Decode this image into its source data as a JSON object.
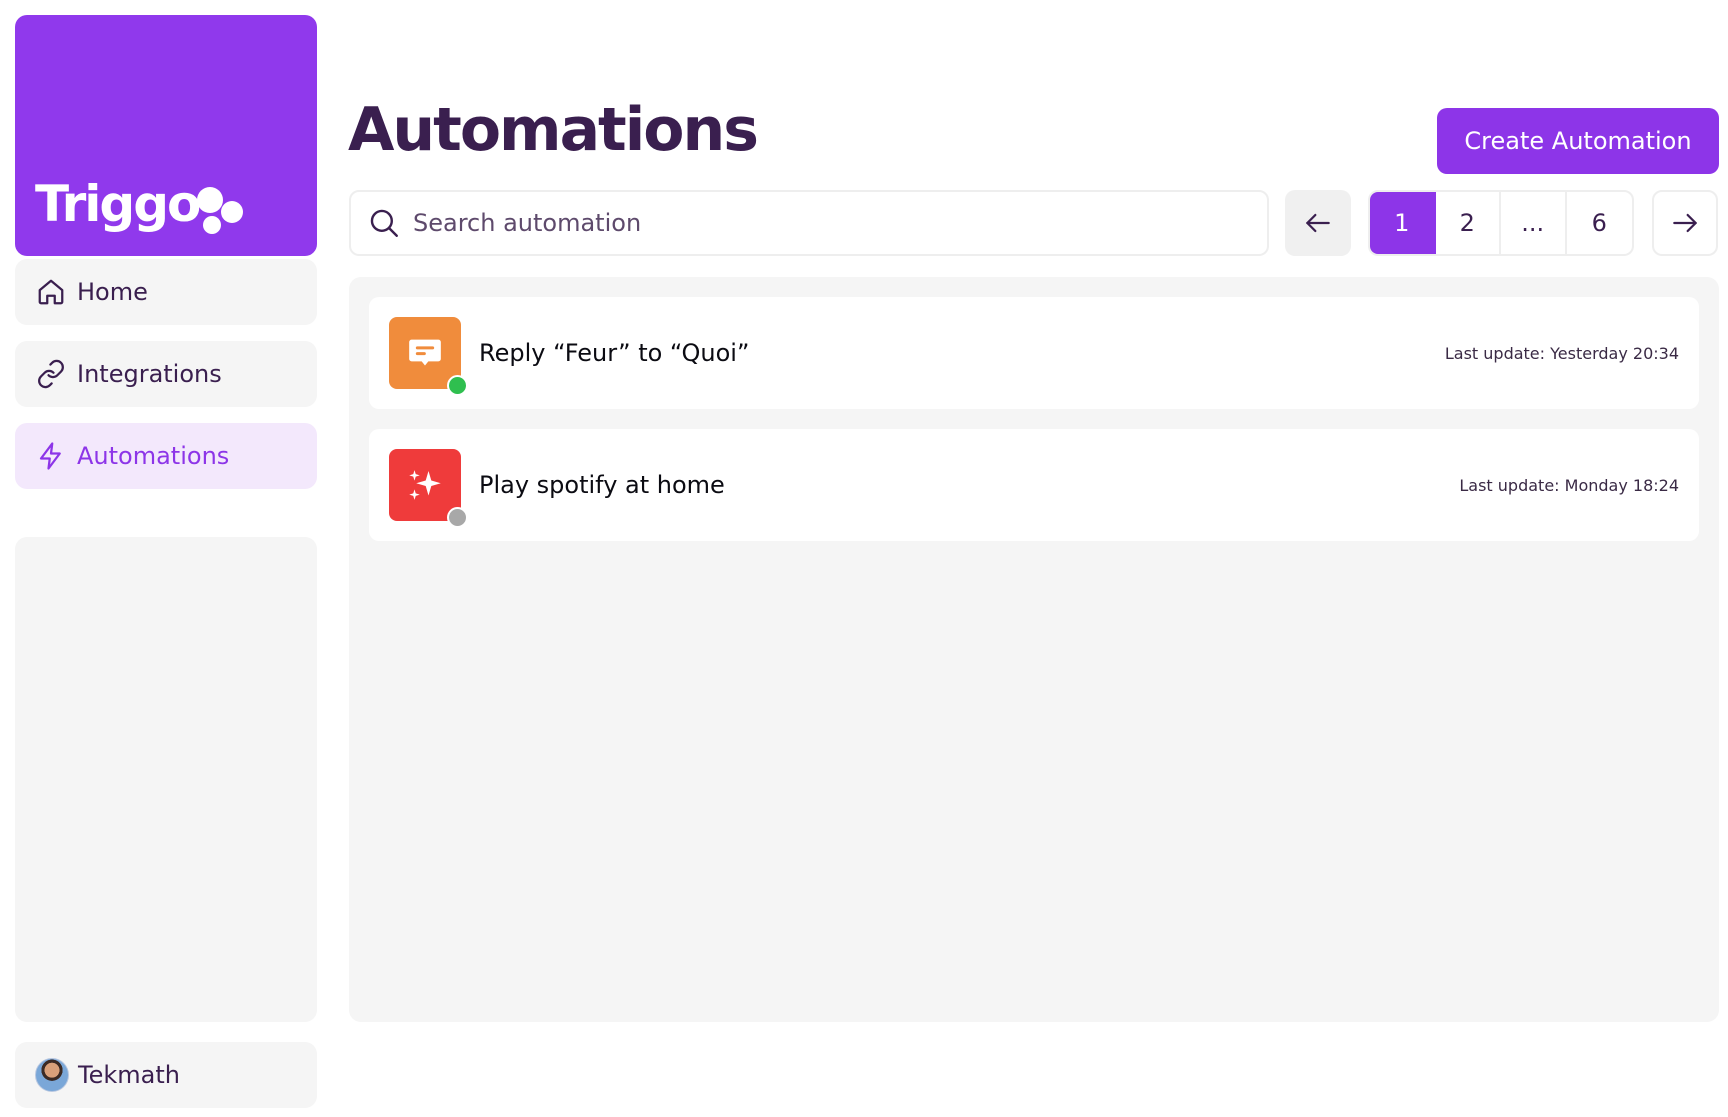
{
  "brand": {
    "name": "Triggo",
    "color": "#9039ec"
  },
  "sidebar": {
    "items": [
      {
        "label": "Home",
        "icon": "home-icon",
        "active": false
      },
      {
        "label": "Integrations",
        "icon": "link-icon",
        "active": false
      },
      {
        "label": "Automations",
        "icon": "lightning-icon",
        "active": true
      }
    ],
    "user": {
      "name": "Tekmath",
      "icon": "avatar"
    }
  },
  "header": {
    "title": "Automations",
    "create_label": "Create Automation"
  },
  "search": {
    "placeholder": "Search automation",
    "value": ""
  },
  "pagination": {
    "prev_icon": "arrow-left-icon",
    "next_icon": "arrow-right-icon",
    "pages": [
      "1",
      "2",
      "...",
      "6"
    ],
    "current": "1"
  },
  "automations": [
    {
      "name": "Reply “Feur” to “Quoi”",
      "updated": "Last update: Yesterday 20:34",
      "icon": "chat-message-icon",
      "icon_color": "#f08c3c",
      "status": "active",
      "status_color": "#2fbf4f"
    },
    {
      "name": "Play spotify at home",
      "updated": "Last update: Monday 18:24",
      "icon": "sparkles-icon",
      "icon_color": "#ef3b3b",
      "status": "inactive",
      "status_color": "#a8a8a8"
    }
  ]
}
